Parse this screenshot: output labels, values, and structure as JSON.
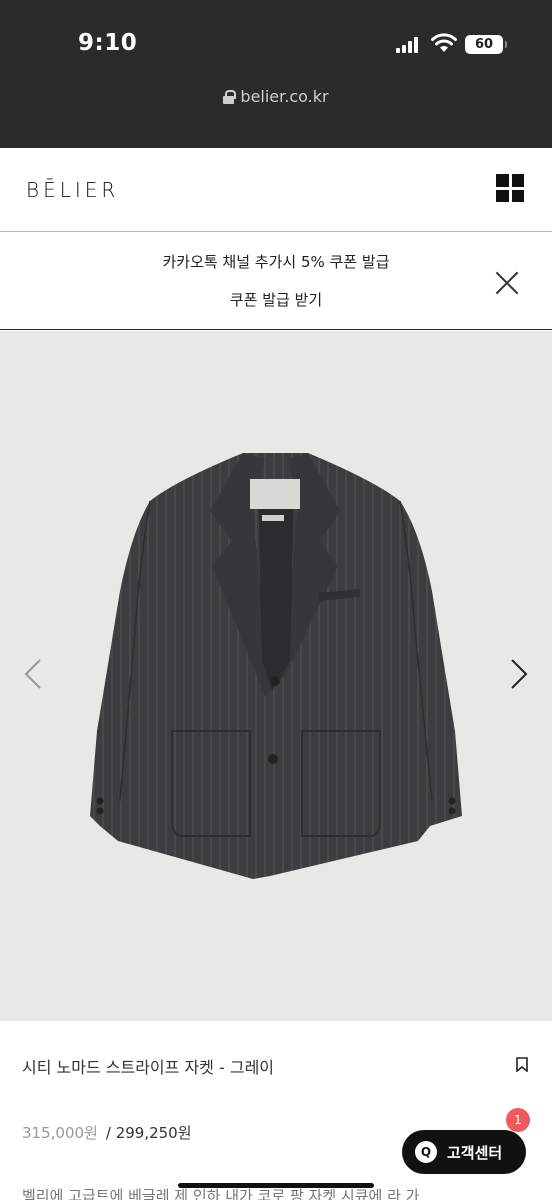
{
  "status_bar": {
    "time": "9:10",
    "battery": "60",
    "icons": [
      "signal-icon",
      "wifi-icon",
      "battery-icon"
    ]
  },
  "browser": {
    "url": "belier.co.kr",
    "lock_icon": "lock-icon"
  },
  "header": {
    "logo": "BĒLIER",
    "menu_icon": "grid-menu-icon"
  },
  "coupon_banner": {
    "line1": "카카오톡 채널 추가시 5% 쿠폰 발급",
    "line2": "쿠폰 발급 받기",
    "close_icon": "close-icon"
  },
  "product": {
    "title": "시티 노마드 스트라이프 자켓 - 그레이",
    "original_price": "315,000원",
    "separator": "/",
    "sale_price": "299,250원",
    "description_partial": "벨리에 고급트에 베글레 제 인하 내가 코로 팡 자켓 시큐에 라 가",
    "bookmark_icon": "bookmark-icon",
    "carousel": {
      "prev_icon": "chevron-left-icon",
      "next_icon": "chevron-right-icon"
    }
  },
  "customer_center": {
    "label": "고객센터",
    "icon_letter": "Q",
    "badge": "1"
  },
  "colors": {
    "status_bg": "#2b2b2b",
    "image_bg": "#e8e8e6",
    "jacket": "#3a3c3d",
    "badge": "#f05a5a"
  }
}
